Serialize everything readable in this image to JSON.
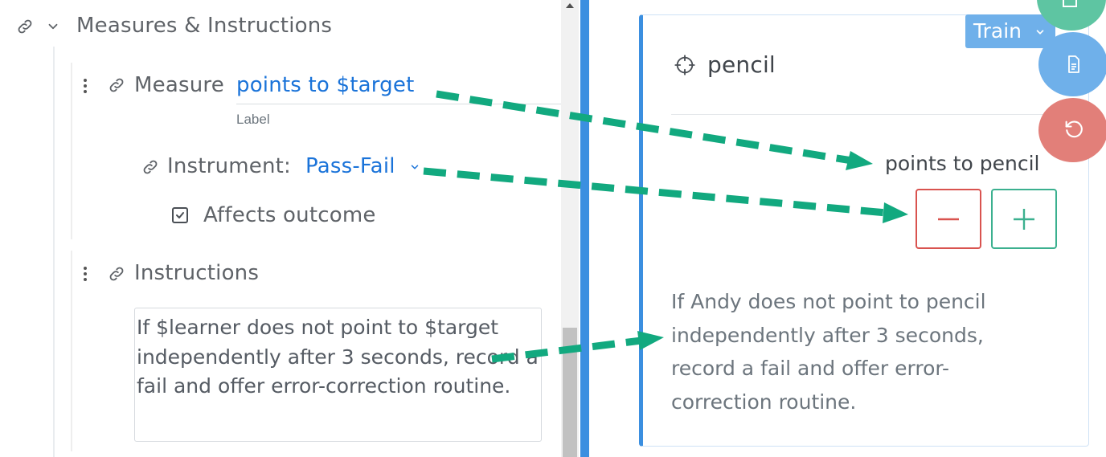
{
  "section": {
    "title": "Measures & Instructions"
  },
  "measure": {
    "label": "Measure",
    "value": "points to $target",
    "hint": "Label"
  },
  "instrument": {
    "label": "Instrument:",
    "value": "Pass-Fail"
  },
  "affects_outcome": {
    "label": "Affects outcome",
    "checked": true
  },
  "instructions": {
    "label": "Instructions",
    "text": "If $learner does not point to $target independently after 3 seconds, record a fail and offer error-correction routine."
  },
  "preview": {
    "mode": "Train",
    "target_name": "pencil",
    "measure_label": "points to pencil",
    "instructions_text": "If Andy does not point to pencil independently after 3 seconds, record a fail and offer error-correction routine."
  },
  "colors": {
    "accent_blue": "#1a73d9",
    "divider_blue": "#3b8fe0",
    "arrow_green": "#12a97f",
    "minus_red": "#d9534f",
    "plus_green": "#3bb08f"
  },
  "icons": {
    "link": "link-icon",
    "chevron": "chevron-down-icon",
    "kebab": "kebab-menu-icon",
    "checkbox": "checkbox-checked-icon",
    "crosshair": "crosshair-icon",
    "document": "document-icon",
    "undo": "undo-icon"
  }
}
